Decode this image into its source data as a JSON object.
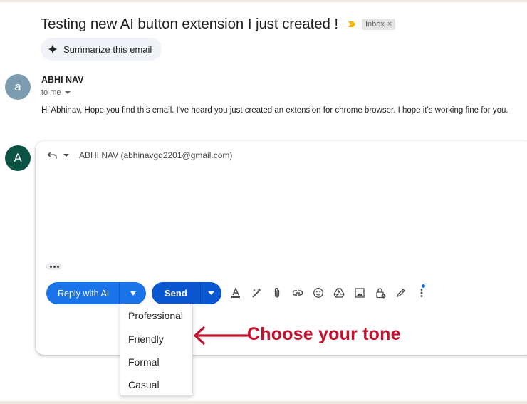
{
  "email": {
    "subject": "Testing new AI button extension I just created !",
    "label": "Inbox",
    "label_close": "×",
    "summarize_label": "Summarize this email",
    "sender": {
      "avatar_letter": "a",
      "name": "ABHI NAV",
      "to_label": "to me",
      "body": "Hi Abhinav, Hope you find this email. I've heard you just created an extension for chrome browser. I hope it's working fine for you."
    }
  },
  "reply": {
    "avatar_letter": "A",
    "recipient": "ABHI NAV (abhinavgd2201@gmail.com)",
    "reply_ai_label": "Reply with AI",
    "send_label": "Send",
    "tone_options": [
      "Professional",
      "Friendly",
      "Formal",
      "Casual"
    ]
  },
  "annotation": {
    "text": "Choose your tone"
  },
  "colors": {
    "primary_blue": "#0b57d0",
    "ai_blue": "#1a73e8",
    "annotation_red": "#c8102e",
    "importance_yellow": "#f4b400"
  },
  "icons": {
    "toolbar": [
      "format-text-icon",
      "ai-write-icon",
      "attach-icon",
      "link-icon",
      "emoji-icon",
      "drive-icon",
      "photo-icon",
      "confidential-lock-icon",
      "signature-pen-icon",
      "more-options-icon"
    ]
  }
}
